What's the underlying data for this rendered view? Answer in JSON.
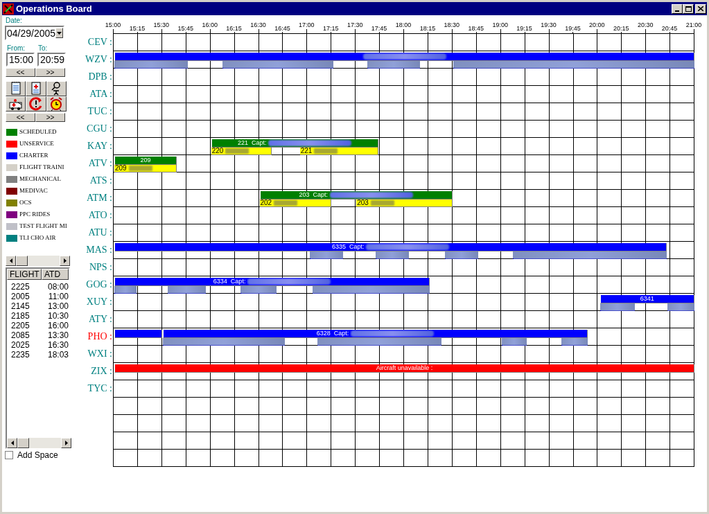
{
  "window": {
    "title": "Operations Board"
  },
  "date": {
    "label": "Date:",
    "value": "04/29/2005"
  },
  "range": {
    "from_label": "From:",
    "from": "15:00",
    "to_label": "To:",
    "to": "20:59",
    "prev": "<<",
    "next": ">>"
  },
  "toolbar": {
    "prev": "<<",
    "next": ">>"
  },
  "legend": [
    {
      "label": "SCHEDULED",
      "color": "#008000"
    },
    {
      "label": "UNSERVICE",
      "color": "#ff0000"
    },
    {
      "label": "CHARTER",
      "color": "#0000ff"
    },
    {
      "label": "FLIGHT TRAINI",
      "color": "#d4d0c8"
    },
    {
      "label": "MECHANICAL",
      "color": "#808080"
    },
    {
      "label": "MEDIVAC",
      "color": "#800000"
    },
    {
      "label": "OCS",
      "color": "#808000"
    },
    {
      "label": "PPC RIDES",
      "color": "#800080"
    },
    {
      "label": "TEST FLIGHT MI",
      "color": "#c0c0c8"
    },
    {
      "label": "TLI CHO AIR",
      "color": "#008080"
    }
  ],
  "flight_table": {
    "columns": [
      "FLIGHT",
      "ATD"
    ],
    "rows": [
      [
        "2225",
        "08:00"
      ],
      [
        "2005",
        "11:00"
      ],
      [
        "2145",
        "13:00"
      ],
      [
        "2185",
        "10:30"
      ],
      [
        "2205",
        "16:00"
      ],
      [
        "2085",
        "13:30"
      ],
      [
        "2025",
        "16:30"
      ],
      [
        "2235",
        "18:03"
      ]
    ]
  },
  "add_space": {
    "label": "Add Space",
    "checked": false
  },
  "timeline": {
    "ticks": [
      "15:00",
      "15:15",
      "15:30",
      "15:45",
      "16:00",
      "16:15",
      "16:30",
      "16:45",
      "17:00",
      "17:15",
      "17:30",
      "17:45",
      "18:00",
      "18:15",
      "18:30",
      "18:45",
      "19:00",
      "19:15",
      "19:30",
      "19:45",
      "20:00",
      "20:15",
      "20:30",
      "20:45",
      "21:00"
    ]
  },
  "rows": [
    {
      "code": "CEV :",
      "color": "#008080"
    },
    {
      "code": "WZV :",
      "color": "#008080",
      "bars": [
        {
          "kind": "charter",
          "redacted_name": true
        }
      ],
      "legs": [
        {
          "kind": "crew"
        },
        {
          "kind": "crew"
        },
        {
          "kind": "crew"
        },
        {
          "kind": "crew"
        }
      ]
    },
    {
      "code": "DPB :",
      "color": "#008080"
    },
    {
      "code": "ATA :",
      "color": "#008080"
    },
    {
      "code": "TUC :",
      "color": "#008080"
    },
    {
      "code": "CGU :",
      "color": "#008080"
    },
    {
      "code": "KAY :",
      "color": "#008080",
      "bars": [
        {
          "kind": "scheduled",
          "label": "221  Capt:",
          "redacted_name": true
        }
      ],
      "legs": [
        {
          "kind": "leg",
          "label": "220"
        },
        {
          "kind": "leg",
          "label": "221"
        }
      ]
    },
    {
      "code": "ATV :",
      "color": "#008080",
      "bars": [
        {
          "kind": "scheduled",
          "label": "209"
        }
      ],
      "legs": [
        {
          "kind": "leg",
          "label": "209"
        }
      ]
    },
    {
      "code": "ATS :",
      "color": "#008080"
    },
    {
      "code": "ATM :",
      "color": "#008080",
      "bars": [
        {
          "kind": "scheduled",
          "label": "203  Capt:",
          "redacted_name": true
        }
      ],
      "legs": [
        {
          "kind": "leg",
          "label": "202"
        },
        {
          "kind": "leg",
          "label": "203"
        }
      ]
    },
    {
      "code": "ATO :",
      "color": "#008080"
    },
    {
      "code": "ATU :",
      "color": "#008080"
    },
    {
      "code": "MAS :",
      "color": "#008080",
      "bars": [
        {
          "kind": "charter",
          "label": "6335  Capt:",
          "redacted_name": true
        }
      ],
      "legs": [
        {
          "kind": "crew"
        },
        {
          "kind": "crew"
        },
        {
          "kind": "crew"
        },
        {
          "kind": "crew"
        }
      ]
    },
    {
      "code": "NPS :",
      "color": "#008080"
    },
    {
      "code": "GOG :",
      "color": "#008080",
      "bars": [
        {
          "kind": "charter",
          "label": "6334  Capt:",
          "redacted_name": true
        }
      ],
      "legs": [
        {
          "kind": "crew"
        },
        {
          "kind": "crew"
        },
        {
          "kind": "crew"
        },
        {
          "kind": "crew"
        }
      ]
    },
    {
      "code": "XUY :",
      "color": "#008080",
      "bars": [
        {
          "kind": "charter",
          "label": "6341"
        }
      ],
      "legs": [
        {
          "kind": "crew"
        },
        {
          "kind": "crew"
        }
      ]
    },
    {
      "code": "ATY :",
      "color": "#008080"
    },
    {
      "code": "PHO :",
      "color": "#ff0000",
      "bars": [
        {
          "kind": "charter"
        },
        {
          "kind": "charter",
          "label": "6328  Capt:",
          "redacted_name": true
        }
      ],
      "legs": [
        {
          "kind": "crew"
        },
        {
          "kind": "crew"
        },
        {
          "kind": "crew"
        },
        {
          "kind": "crew"
        }
      ]
    },
    {
      "code": "WXI :",
      "color": "#008080"
    },
    {
      "code": "ZIX :",
      "color": "#008080",
      "bars": [
        {
          "kind": "unservice",
          "label": "Aircraft unavailable :"
        }
      ]
    },
    {
      "code": "TYC :",
      "color": "#008080"
    },
    {},
    {},
    {},
    {}
  ]
}
